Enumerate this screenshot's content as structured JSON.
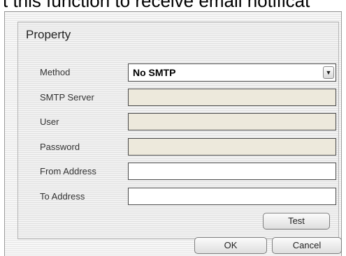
{
  "background_text": "t this function to receive email notificat",
  "panel": {
    "title": "Property",
    "method": {
      "label": "Method",
      "value": "No SMTP"
    },
    "smtp_server": {
      "label": "SMTP Server",
      "value": ""
    },
    "user": {
      "label": "User",
      "value": ""
    },
    "password": {
      "label": "Password",
      "value": ""
    },
    "from_address": {
      "label": "From Address",
      "value": ""
    },
    "to_address": {
      "label": "To Address",
      "value": ""
    },
    "test_label": "Test"
  },
  "footer": {
    "ok_label": "OK",
    "cancel_label": "Cancel"
  },
  "colors": {
    "disabled_field": "#ede9dc",
    "field_border": "#4a4a4a"
  },
  "icons": {
    "dropdown": "chevron-down-icon"
  }
}
